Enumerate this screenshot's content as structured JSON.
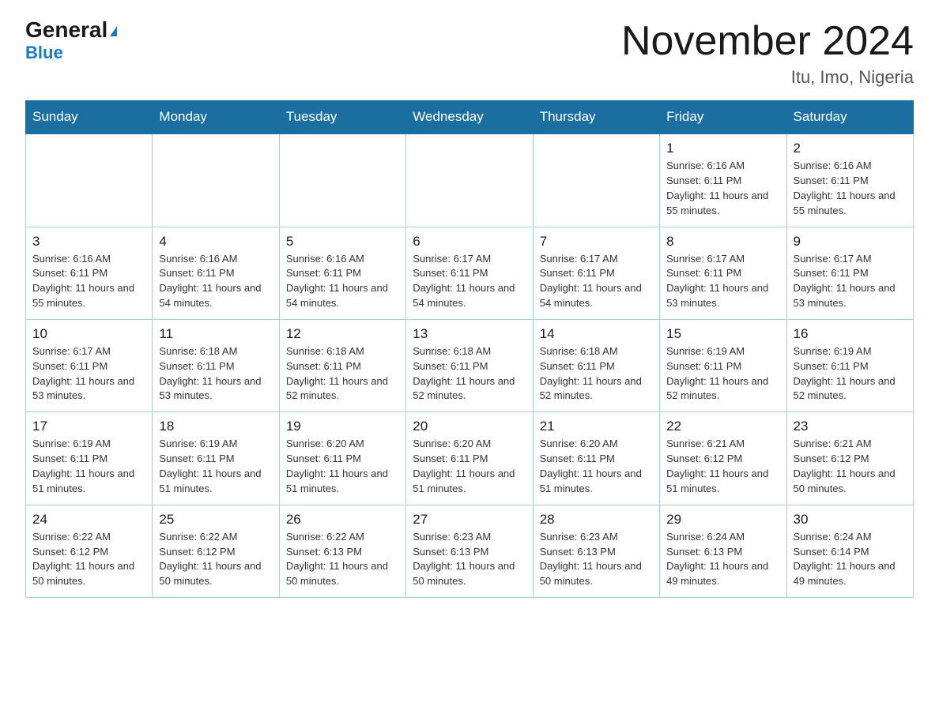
{
  "header": {
    "logo_general": "General",
    "logo_blue": "Blue",
    "main_title": "November 2024",
    "subtitle": "Itu, Imo, Nigeria"
  },
  "weekdays": [
    "Sunday",
    "Monday",
    "Tuesday",
    "Wednesday",
    "Thursday",
    "Friday",
    "Saturday"
  ],
  "weeks": [
    {
      "days": [
        {
          "num": "",
          "info": ""
        },
        {
          "num": "",
          "info": ""
        },
        {
          "num": "",
          "info": ""
        },
        {
          "num": "",
          "info": ""
        },
        {
          "num": "",
          "info": ""
        },
        {
          "num": "1",
          "info": "Sunrise: 6:16 AM\nSunset: 6:11 PM\nDaylight: 11 hours and 55 minutes."
        },
        {
          "num": "2",
          "info": "Sunrise: 6:16 AM\nSunset: 6:11 PM\nDaylight: 11 hours and 55 minutes."
        }
      ]
    },
    {
      "days": [
        {
          "num": "3",
          "info": "Sunrise: 6:16 AM\nSunset: 6:11 PM\nDaylight: 11 hours and 55 minutes."
        },
        {
          "num": "4",
          "info": "Sunrise: 6:16 AM\nSunset: 6:11 PM\nDaylight: 11 hours and 54 minutes."
        },
        {
          "num": "5",
          "info": "Sunrise: 6:16 AM\nSunset: 6:11 PM\nDaylight: 11 hours and 54 minutes."
        },
        {
          "num": "6",
          "info": "Sunrise: 6:17 AM\nSunset: 6:11 PM\nDaylight: 11 hours and 54 minutes."
        },
        {
          "num": "7",
          "info": "Sunrise: 6:17 AM\nSunset: 6:11 PM\nDaylight: 11 hours and 54 minutes."
        },
        {
          "num": "8",
          "info": "Sunrise: 6:17 AM\nSunset: 6:11 PM\nDaylight: 11 hours and 53 minutes."
        },
        {
          "num": "9",
          "info": "Sunrise: 6:17 AM\nSunset: 6:11 PM\nDaylight: 11 hours and 53 minutes."
        }
      ]
    },
    {
      "days": [
        {
          "num": "10",
          "info": "Sunrise: 6:17 AM\nSunset: 6:11 PM\nDaylight: 11 hours and 53 minutes."
        },
        {
          "num": "11",
          "info": "Sunrise: 6:18 AM\nSunset: 6:11 PM\nDaylight: 11 hours and 53 minutes."
        },
        {
          "num": "12",
          "info": "Sunrise: 6:18 AM\nSunset: 6:11 PM\nDaylight: 11 hours and 52 minutes."
        },
        {
          "num": "13",
          "info": "Sunrise: 6:18 AM\nSunset: 6:11 PM\nDaylight: 11 hours and 52 minutes."
        },
        {
          "num": "14",
          "info": "Sunrise: 6:18 AM\nSunset: 6:11 PM\nDaylight: 11 hours and 52 minutes."
        },
        {
          "num": "15",
          "info": "Sunrise: 6:19 AM\nSunset: 6:11 PM\nDaylight: 11 hours and 52 minutes."
        },
        {
          "num": "16",
          "info": "Sunrise: 6:19 AM\nSunset: 6:11 PM\nDaylight: 11 hours and 52 minutes."
        }
      ]
    },
    {
      "days": [
        {
          "num": "17",
          "info": "Sunrise: 6:19 AM\nSunset: 6:11 PM\nDaylight: 11 hours and 51 minutes."
        },
        {
          "num": "18",
          "info": "Sunrise: 6:19 AM\nSunset: 6:11 PM\nDaylight: 11 hours and 51 minutes."
        },
        {
          "num": "19",
          "info": "Sunrise: 6:20 AM\nSunset: 6:11 PM\nDaylight: 11 hours and 51 minutes."
        },
        {
          "num": "20",
          "info": "Sunrise: 6:20 AM\nSunset: 6:11 PM\nDaylight: 11 hours and 51 minutes."
        },
        {
          "num": "21",
          "info": "Sunrise: 6:20 AM\nSunset: 6:11 PM\nDaylight: 11 hours and 51 minutes."
        },
        {
          "num": "22",
          "info": "Sunrise: 6:21 AM\nSunset: 6:12 PM\nDaylight: 11 hours and 51 minutes."
        },
        {
          "num": "23",
          "info": "Sunrise: 6:21 AM\nSunset: 6:12 PM\nDaylight: 11 hours and 50 minutes."
        }
      ]
    },
    {
      "days": [
        {
          "num": "24",
          "info": "Sunrise: 6:22 AM\nSunset: 6:12 PM\nDaylight: 11 hours and 50 minutes."
        },
        {
          "num": "25",
          "info": "Sunrise: 6:22 AM\nSunset: 6:12 PM\nDaylight: 11 hours and 50 minutes."
        },
        {
          "num": "26",
          "info": "Sunrise: 6:22 AM\nSunset: 6:13 PM\nDaylight: 11 hours and 50 minutes."
        },
        {
          "num": "27",
          "info": "Sunrise: 6:23 AM\nSunset: 6:13 PM\nDaylight: 11 hours and 50 minutes."
        },
        {
          "num": "28",
          "info": "Sunrise: 6:23 AM\nSunset: 6:13 PM\nDaylight: 11 hours and 50 minutes."
        },
        {
          "num": "29",
          "info": "Sunrise: 6:24 AM\nSunset: 6:13 PM\nDaylight: 11 hours and 49 minutes."
        },
        {
          "num": "30",
          "info": "Sunrise: 6:24 AM\nSunset: 6:14 PM\nDaylight: 11 hours and 49 minutes."
        }
      ]
    }
  ]
}
